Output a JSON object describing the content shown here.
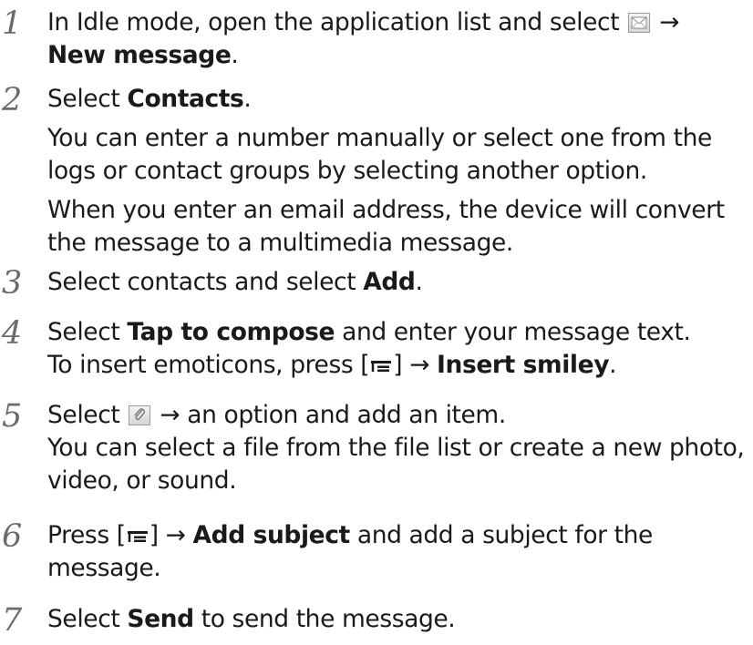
{
  "steps": [
    {
      "number": "1",
      "line1_text": "In Idle mode, open the application list and select",
      "line1_icon": "message-envelope-icon",
      "line1_arrow": "→",
      "line2_bold": "New message",
      "line2_end": "."
    },
    {
      "number": "2",
      "line1_text": "Select ",
      "line1_bold": "Contacts",
      "line1_end": ".",
      "line2": "You can enter a number manually or select one from the",
      "line3": "logs or contact groups by selecting another option.",
      "line4": "When you enter an email address, the device will convert",
      "line5": "the message to a multimedia message."
    },
    {
      "number": "3",
      "line1_text": "Select contacts and select ",
      "line1_bold": "Add",
      "line1_end": "."
    },
    {
      "number": "4",
      "line1_text": "Select ",
      "line1_bold": "Tap to compose",
      "line1_end": " and enter your message text.",
      "line2_text": "To insert emoticons, press [",
      "line2_icon": "menu-key-icon",
      "line2_mid": "] → ",
      "line2_bold": "Insert smiley",
      "line2_end": "."
    },
    {
      "number": "5",
      "line1_text": "Select",
      "line1_icon": "paperclip-attach-icon",
      "line1_end": "→ an option and add an item.",
      "line2": "You can select a file from the file list or create a new photo,",
      "line3": "video, or sound."
    },
    {
      "number": "6",
      "line1_text": "Press [",
      "line1_icon": "menu-key-icon",
      "line1_mid": "] → ",
      "line1_bold": "Add subject",
      "line1_end": " and add a subject for the",
      "line2": "message."
    },
    {
      "number": "7",
      "line1_text": "Select ",
      "line1_bold": "Send",
      "line1_end": " to send the message."
    }
  ]
}
